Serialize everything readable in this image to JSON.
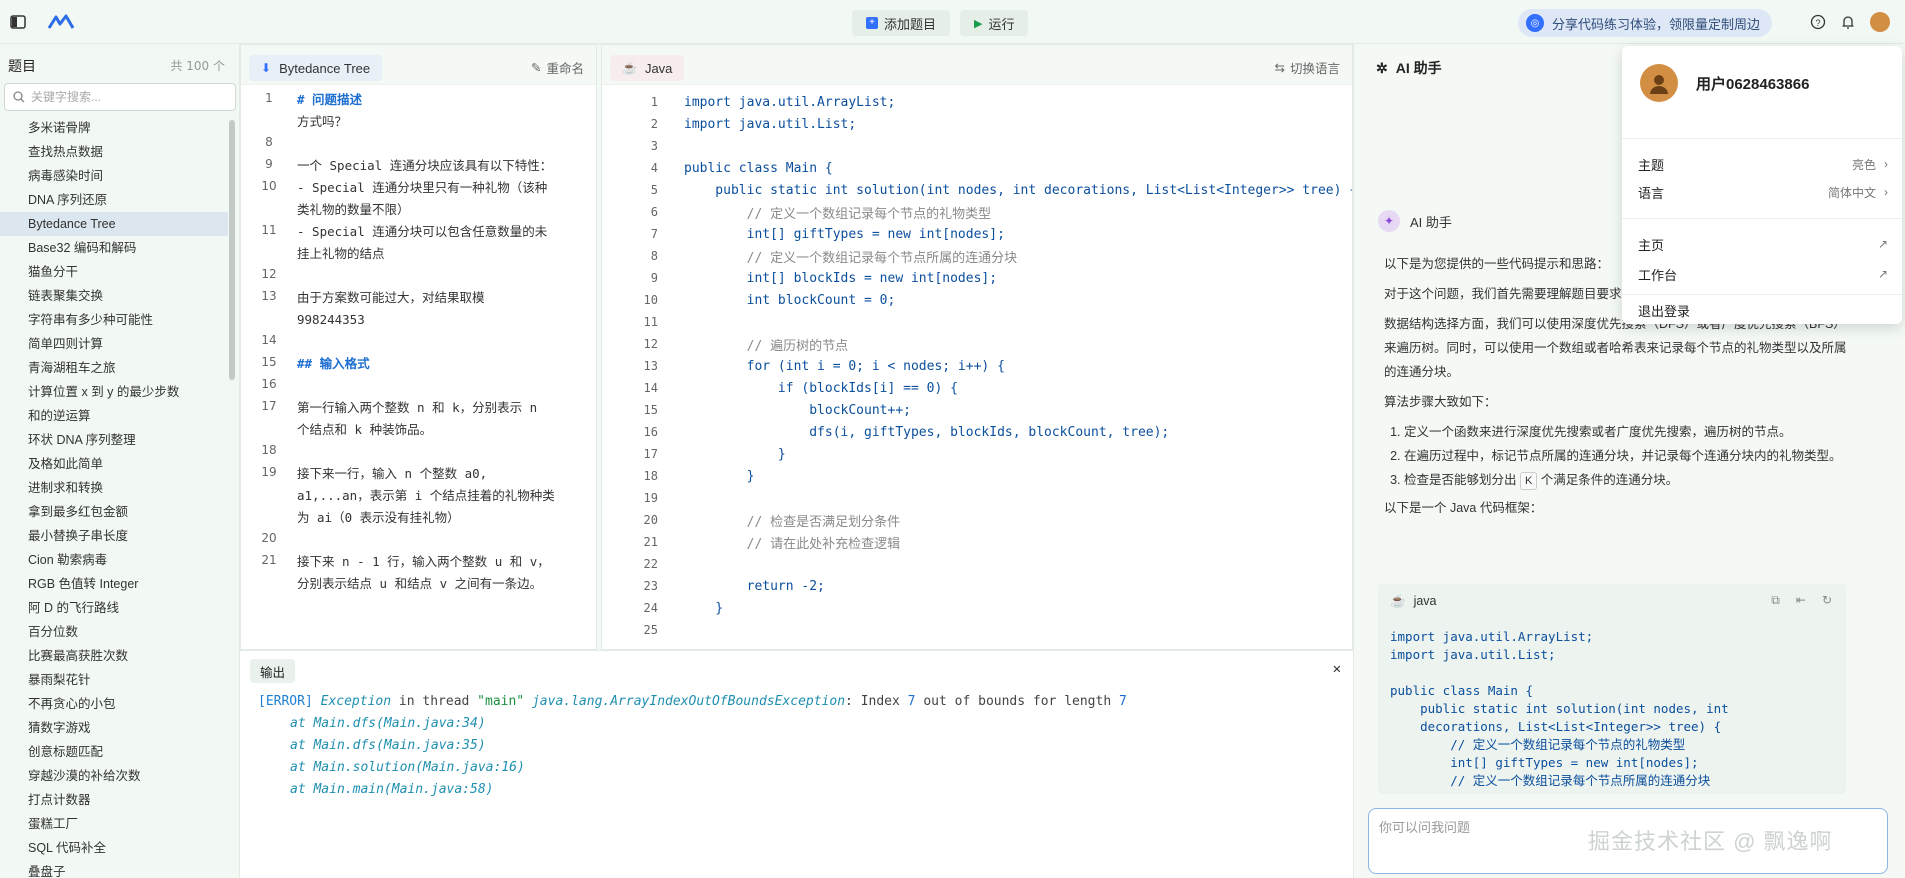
{
  "topbar": {
    "add_label": "添加题目",
    "run_label": "运行",
    "promo": "分享代码练习体验，领限量定制周边"
  },
  "sidebar": {
    "title": "题目",
    "count": "共 100 个",
    "search_placeholder": "关键字搜索...",
    "items": [
      "多米诺骨牌",
      "查找热点数据",
      "病毒感染时间",
      "DNA 序列还原",
      "Bytedance Tree",
      "Base32 编码和解码",
      "猫鱼分干",
      "链表聚集交换",
      "字符串有多少种可能性",
      "简单四则计算",
      "青海湖租车之旅",
      "计算位置 x 到 y 的最少步数",
      "和的逆运算",
      "环状 DNA 序列整理",
      "及格如此简单",
      "进制求和转换",
      "拿到最多红包金额",
      "最小替换子串长度",
      "Cion 勒索病毒",
      "RGB 色值转 Integer",
      "阿 D 的飞行路线",
      "百分位数",
      "比赛最高获胜次数",
      "暴雨梨花针",
      "不再贪心的小包",
      "猜数字游戏",
      "创意标题匹配",
      "穿越沙漠的补给次数",
      "打点计数器",
      "蛋糕工厂",
      "SQL 代码补全",
      "叠盘子"
    ],
    "active_index": 4
  },
  "desc": {
    "tab": "Bytedance Tree",
    "rename": "重命名",
    "lines": [
      {
        "n": "1",
        "t": "# 问题描述",
        "h": true
      },
      {
        "n": "",
        "t": "方式吗？",
        "h": false
      },
      {
        "n": "8",
        "t": "",
        "h": false
      },
      {
        "n": "9",
        "t": "一个 Special 连通分块应该具有以下特性：",
        "h": false
      },
      {
        "n": "10",
        "t": "- Special 连通分块里只有一种礼物（该种类礼物的数量不限）",
        "h": false
      },
      {
        "n": "11",
        "t": "- Special 连通分块可以包含任意数量的未挂上礼物的结点",
        "h": false
      },
      {
        "n": "12",
        "t": "",
        "h": false
      },
      {
        "n": "13",
        "t": "由于方案数可能过大，对结果取模 998244353",
        "h": false
      },
      {
        "n": "14",
        "t": "",
        "h": false
      },
      {
        "n": "15",
        "t": "## 输入格式",
        "h": true
      },
      {
        "n": "16",
        "t": "",
        "h": false
      },
      {
        "n": "17",
        "t": "第一行输入两个整数 n 和 k，分别表示 n 个结点和 k 种装饰品。",
        "h": false
      },
      {
        "n": "18",
        "t": "",
        "h": false
      },
      {
        "n": "19",
        "t": "接下来一行，输入 n 个整数 a0, a1,...an，表示第 i 个结点挂着的礼物种类为 ai（0 表示没有挂礼物）",
        "h": false
      },
      {
        "n": "20",
        "t": "",
        "h": false
      },
      {
        "n": "21",
        "t": "接下来 n - 1 行，输入两个整数 u 和 v，分别表示结点 u 和结点 v 之间有一条边。",
        "h": false
      }
    ]
  },
  "editor": {
    "tab": "Java",
    "switch": "切换语言",
    "lines": [
      {
        "n": "1",
        "c": "import java.util.ArrayList;",
        "k": "code"
      },
      {
        "n": "2",
        "c": "import java.util.List;",
        "k": "code"
      },
      {
        "n": "3",
        "c": "",
        "k": "code"
      },
      {
        "n": "4",
        "c": "public class Main {",
        "k": "code"
      },
      {
        "n": "5",
        "c": "    public static int solution(int nodes, int decorations, List<List<Integer>> tree) {",
        "k": "code"
      },
      {
        "n": "6",
        "c": "        // 定义一个数组记录每个节点的礼物类型",
        "k": "cm"
      },
      {
        "n": "7",
        "c": "        int[] giftTypes = new int[nodes];",
        "k": "code"
      },
      {
        "n": "8",
        "c": "        // 定义一个数组记录每个节点所属的连通分块",
        "k": "cm"
      },
      {
        "n": "9",
        "c": "        int[] blockIds = new int[nodes];",
        "k": "code"
      },
      {
        "n": "10",
        "c": "        int blockCount = 0;",
        "k": "code"
      },
      {
        "n": "11",
        "c": "",
        "k": "code"
      },
      {
        "n": "12",
        "c": "        // 遍历树的节点",
        "k": "cm"
      },
      {
        "n": "13",
        "c": "        for (int i = 0; i < nodes; i++) {",
        "k": "code"
      },
      {
        "n": "14",
        "c": "            if (blockIds[i] == 0) {",
        "k": "code"
      },
      {
        "n": "15",
        "c": "                blockCount++;",
        "k": "code"
      },
      {
        "n": "16",
        "c": "                dfs(i, giftTypes, blockIds, blockCount, tree);",
        "k": "code"
      },
      {
        "n": "17",
        "c": "            }",
        "k": "code"
      },
      {
        "n": "18",
        "c": "        }",
        "k": "code"
      },
      {
        "n": "19",
        "c": "",
        "k": "code"
      },
      {
        "n": "20",
        "c": "        // 检查是否满足划分条件",
        "k": "cm"
      },
      {
        "n": "21",
        "c": "        // 请在此处补充检查逻辑",
        "k": "cm"
      },
      {
        "n": "22",
        "c": "",
        "k": "code"
      },
      {
        "n": "23",
        "c": "        return -2;",
        "k": "code"
      },
      {
        "n": "24",
        "c": "    }",
        "k": "code"
      },
      {
        "n": "25",
        "c": "",
        "k": "code"
      }
    ]
  },
  "output": {
    "tab": "输出",
    "error_tag": "[ERROR]",
    "exception": "Exception",
    "in_thread": " in thread ",
    "thread": "\"main\"",
    "ex_class": "java.lang.ArrayIndexOutOfBoundsException",
    "msg_a": ": Index ",
    "idx": "7",
    "msg_b": " out of bounds for length ",
    "len": "7",
    "stack": [
      "at Main.dfs(Main.java:34)",
      "at Main.dfs(Main.java:35)",
      "at Main.solution(Main.java:16)",
      "at Main.main(Main.java:58)"
    ]
  },
  "ai": {
    "title": "AI 助手",
    "bot_name": "AI 助手",
    "p1": "以下是为您提供的一些代码提示和思路：",
    "p2": "对于这个问题，我们首先需要理解题目要求，……每个分块内只有一种礼物。",
    "p3": "数据结构选择方面，我们可以使用深度优先搜索（DFS）或者广度优先搜索（BFS）来遍历树。同时，可以使用一个数组或者哈希表来记录每个节点的礼物类型以及所属的连通分块。",
    "p4": "算法步骤大致如下：",
    "steps": [
      "定义一个函数来进行深度优先搜索或者广度优先搜索，遍历树的节点。",
      "在遍历过程中，标记节点所属的连通分块，并记录每个连通分块内的礼物类型。"
    ],
    "step3_a": "检查是否能够划分出 ",
    "step3_k": "K",
    "step3_b": " 个满足条件的连通分块。",
    "p5": "以下是一个 Java 代码框架：",
    "code_lang": "java",
    "code": "import java.util.ArrayList;\nimport java.util.List;\n\npublic class Main {\n    public static int solution(int nodes, int\n    decorations, List<List<Integer>> tree) {\n        // 定义一个数组记录每个节点的礼物类型\n        int[] giftTypes = new int[nodes];\n        // 定义一个数组记录每个节点所属的连通分块",
    "input_placeholder": "你可以问我问题",
    "watermark": "掘金技术社区 @ 飘逸啊"
  },
  "menu": {
    "username": "用户0628463866",
    "theme": "主题",
    "theme_val": "亮色",
    "lang": "语言",
    "lang_val": "简体中文",
    "home": "主页",
    "workspace": "工作台",
    "logout": "退出登录"
  }
}
